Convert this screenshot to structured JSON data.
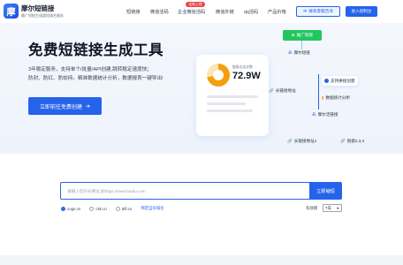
{
  "brand": {
    "logo_text": "摩",
    "name": "摩尔短链接",
    "tagline": "最广短链生成超短域名服务"
  },
  "nav": {
    "items": [
      "短链接",
      "微信活码",
      "企业微信活码",
      "微信外链",
      "qq活码",
      "产品价格"
    ],
    "hot_badge": "全新上线",
    "contact_button": "联系客服咨询",
    "console_button": "进入控制台"
  },
  "hero": {
    "title": "免费短链接生成工具",
    "desc_line1": "3年稳定服务，支持单个/批量/API创建,跳转稳定速度快；",
    "desc_line2": "防封、防红、防劫持，精准数据统计分析，数据报表一键导出!",
    "cta_button": "立即前往免费创建"
  },
  "illustration": {
    "donut_fraction": 0.72,
    "stat_label": "链接点击次数",
    "stat_value": "72.9W",
    "green_pill": "推广链接",
    "node_short": "摩尔短链",
    "node_long_url": "长链接地址",
    "node_custom": "支持拼接创建",
    "node_stats": "数据统计分析",
    "node_short2": "摩尔活链接",
    "node_long1": "长链接地址1",
    "node_link234": "链接2,3,4"
  },
  "converter": {
    "input_placeholder": "请输入您的长网址,如https://www.baidu.com",
    "submit_button": "立即缩短",
    "domains": [
      "coge.cn",
      "ckk.cn",
      "5ifl.cn"
    ],
    "selected_domain": 0,
    "bind_domain_link": "绑定自有域名",
    "expiry_label": "有效期",
    "expiry_value": "7天"
  },
  "colors": {
    "primary": "#2563eb",
    "accent_green": "#22c55e",
    "donut": "#f59e0b",
    "hot": "#ef4444"
  }
}
